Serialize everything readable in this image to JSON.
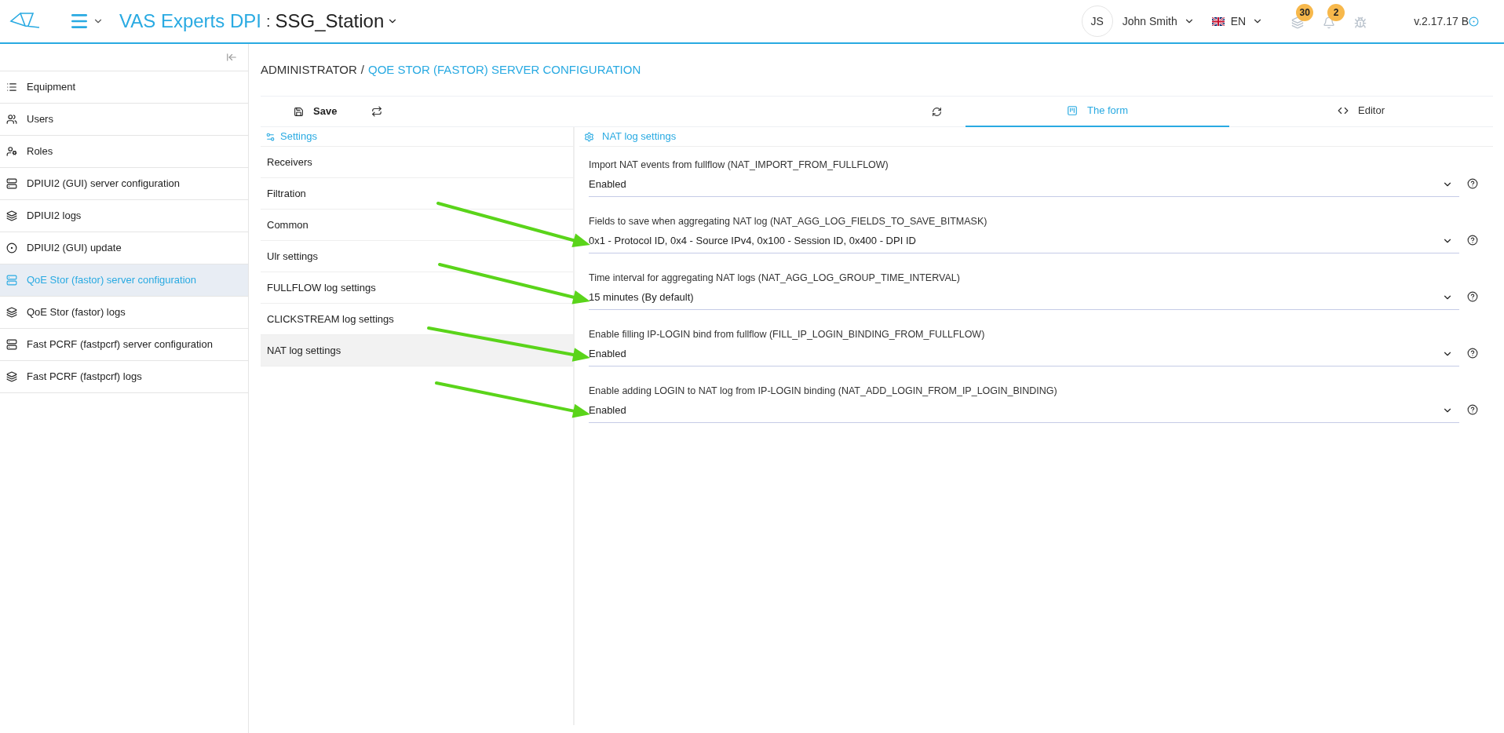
{
  "header": {
    "brand": "VAS Experts DPI",
    "separator": ":",
    "station": "SSG_Station",
    "user_initials": "JS",
    "user_name": "John Smith",
    "language": "EN",
    "badges": [
      {
        "kind": "logs",
        "count": "30"
      },
      {
        "kind": "bell",
        "count": "2"
      },
      {
        "kind": "bug"
      }
    ],
    "version": "v.2.17.17 B"
  },
  "sidebar": {
    "items": [
      {
        "kind": "list",
        "label": "Equipment",
        "selected": false
      },
      {
        "kind": "users",
        "label": "Users",
        "selected": false
      },
      {
        "kind": "roles",
        "label": "Roles",
        "selected": false
      },
      {
        "kind": "server",
        "label": "DPIUI2 (GUI) server configuration",
        "selected": false
      },
      {
        "kind": "logs",
        "label": "DPIUI2 logs",
        "selected": false
      },
      {
        "kind": "update",
        "label": "DPIUI2 (GUI) update",
        "selected": false
      },
      {
        "kind": "server",
        "label": "QoE Stor (fastor) server configuration",
        "selected": true
      },
      {
        "kind": "logs",
        "label": "QoE Stor (fastor) logs",
        "selected": false
      },
      {
        "kind": "server",
        "label": "Fast PCRF (fastpcrf) server configuration",
        "selected": false
      },
      {
        "kind": "logs",
        "label": "Fast PCRF (fastpcrf) logs",
        "selected": false
      }
    ]
  },
  "breadcrumb": {
    "root": "ADMINISTRATOR",
    "separator": "/",
    "current": "QOE STOR (FASTOR) SERVER CONFIGURATION"
  },
  "toolbar": {
    "save": "Save"
  },
  "tabs": [
    {
      "kind": "form",
      "label": "The form",
      "selected": true
    },
    {
      "kind": "editor",
      "label": "Editor",
      "selected": false
    }
  ],
  "settings": {
    "title": "Settings",
    "items": [
      {
        "label": "Receivers",
        "selected": false
      },
      {
        "label": "Filtration",
        "selected": false
      },
      {
        "label": "Common",
        "selected": false
      },
      {
        "label": "Ulr settings",
        "selected": false
      },
      {
        "label": "FULLFLOW log settings",
        "selected": false
      },
      {
        "label": "CLICKSTREAM log settings",
        "selected": false
      },
      {
        "label": "NAT log settings",
        "selected": true
      }
    ]
  },
  "section": {
    "title": "NAT log settings",
    "fields": [
      {
        "label": "Import NAT events from fullflow (NAT_IMPORT_FROM_FULLFLOW)",
        "value": "Enabled",
        "highlighted": false
      },
      {
        "label": "Fields to save when aggregating NAT log (NAT_AGG_LOG_FIELDS_TO_SAVE_BITMASK)",
        "value": "0x1 - Protocol ID, 0x4 - Source IPv4, 0x100 - Session ID, 0x400 - DPI ID",
        "highlighted": true
      },
      {
        "label": "Time interval for aggregating NAT logs (NAT_AGG_LOG_GROUP_TIME_INTERVAL)",
        "value": "15 minutes (By default)",
        "highlighted": true
      },
      {
        "label": "Enable filling IP-LOGIN bind from fullflow (FILL_IP_LOGIN_BINDING_FROM_FULLFLOW)",
        "value": "Enabled",
        "highlighted": true
      },
      {
        "label": "Enable adding LOGIN to NAT log from IP-LOGIN binding (NAT_ADD_LOGIN_FROM_IP_LOGIN_BINDING)",
        "value": "Enabled",
        "highlighted": true
      }
    ]
  }
}
